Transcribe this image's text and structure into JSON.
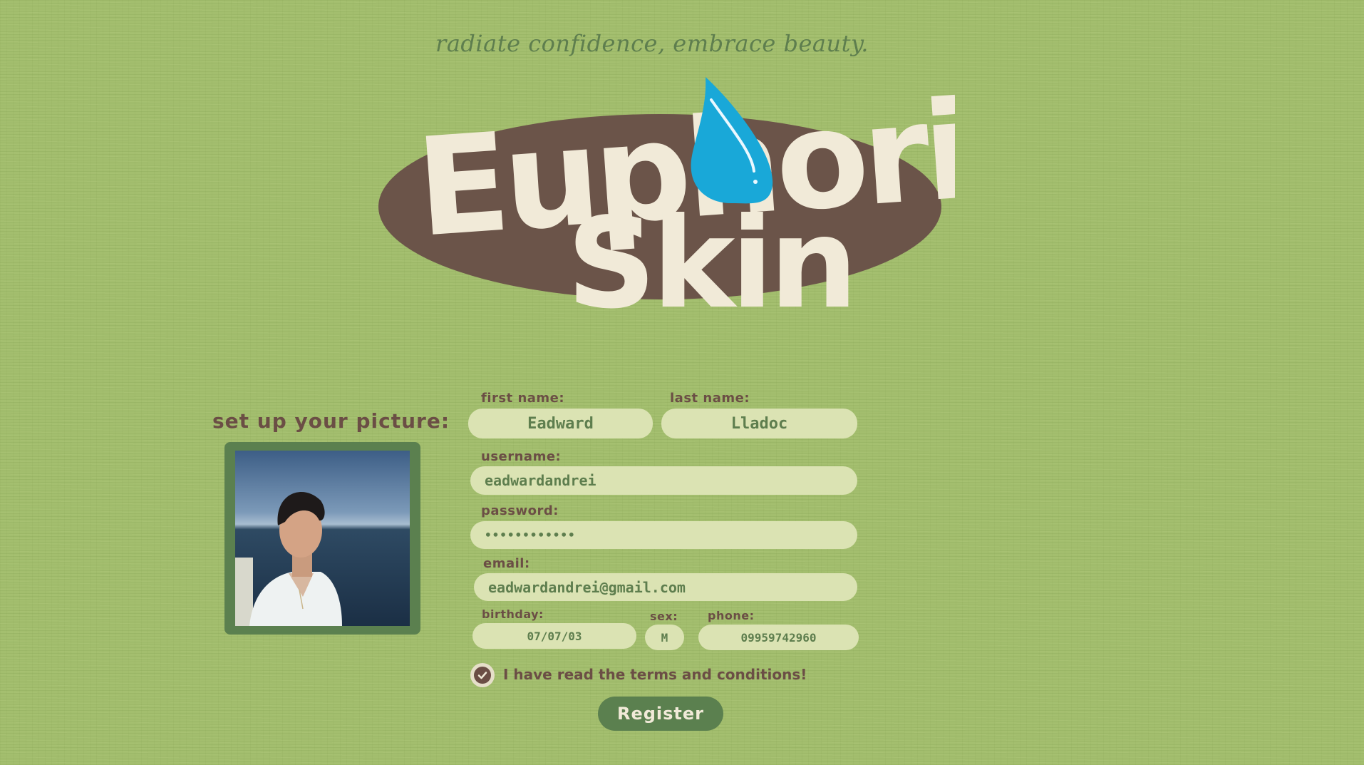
{
  "tagline": "radiate confidence, embrace beauty.",
  "logo": {
    "line1": "Euphoric",
    "line2": "Skin",
    "colors": {
      "ellipse": "#6b5449",
      "letters": "#f1ead8",
      "droplet": "#19a8d8"
    }
  },
  "picture": {
    "label": "set up your picture:",
    "frame_color": "#5b804f"
  },
  "form": {
    "first_name": {
      "label": "first name:",
      "value": "Eadward"
    },
    "last_name": {
      "label": "last name:",
      "value": "Lladoc"
    },
    "username": {
      "label": "username:",
      "value": "eadwardandrei"
    },
    "password": {
      "label": "password:",
      "value": "••••••••••••"
    },
    "email": {
      "label": "email:",
      "value": "eadwardandrei@gmail.com"
    },
    "birthday": {
      "label": "birthday:",
      "value": "07/07/03"
    },
    "sex": {
      "label": "sex:",
      "value": "M"
    },
    "phone": {
      "label": "phone:",
      "value": "09959742960"
    },
    "terms": {
      "label": "I have read the terms and conditions!",
      "checked": true
    },
    "register_label": "Register"
  },
  "colors": {
    "background": "#a3be6e",
    "label_text": "#6b4e45",
    "field_bg": "#dbe3b3",
    "field_text": "#5e7e4e",
    "accent": "#5b804f"
  }
}
